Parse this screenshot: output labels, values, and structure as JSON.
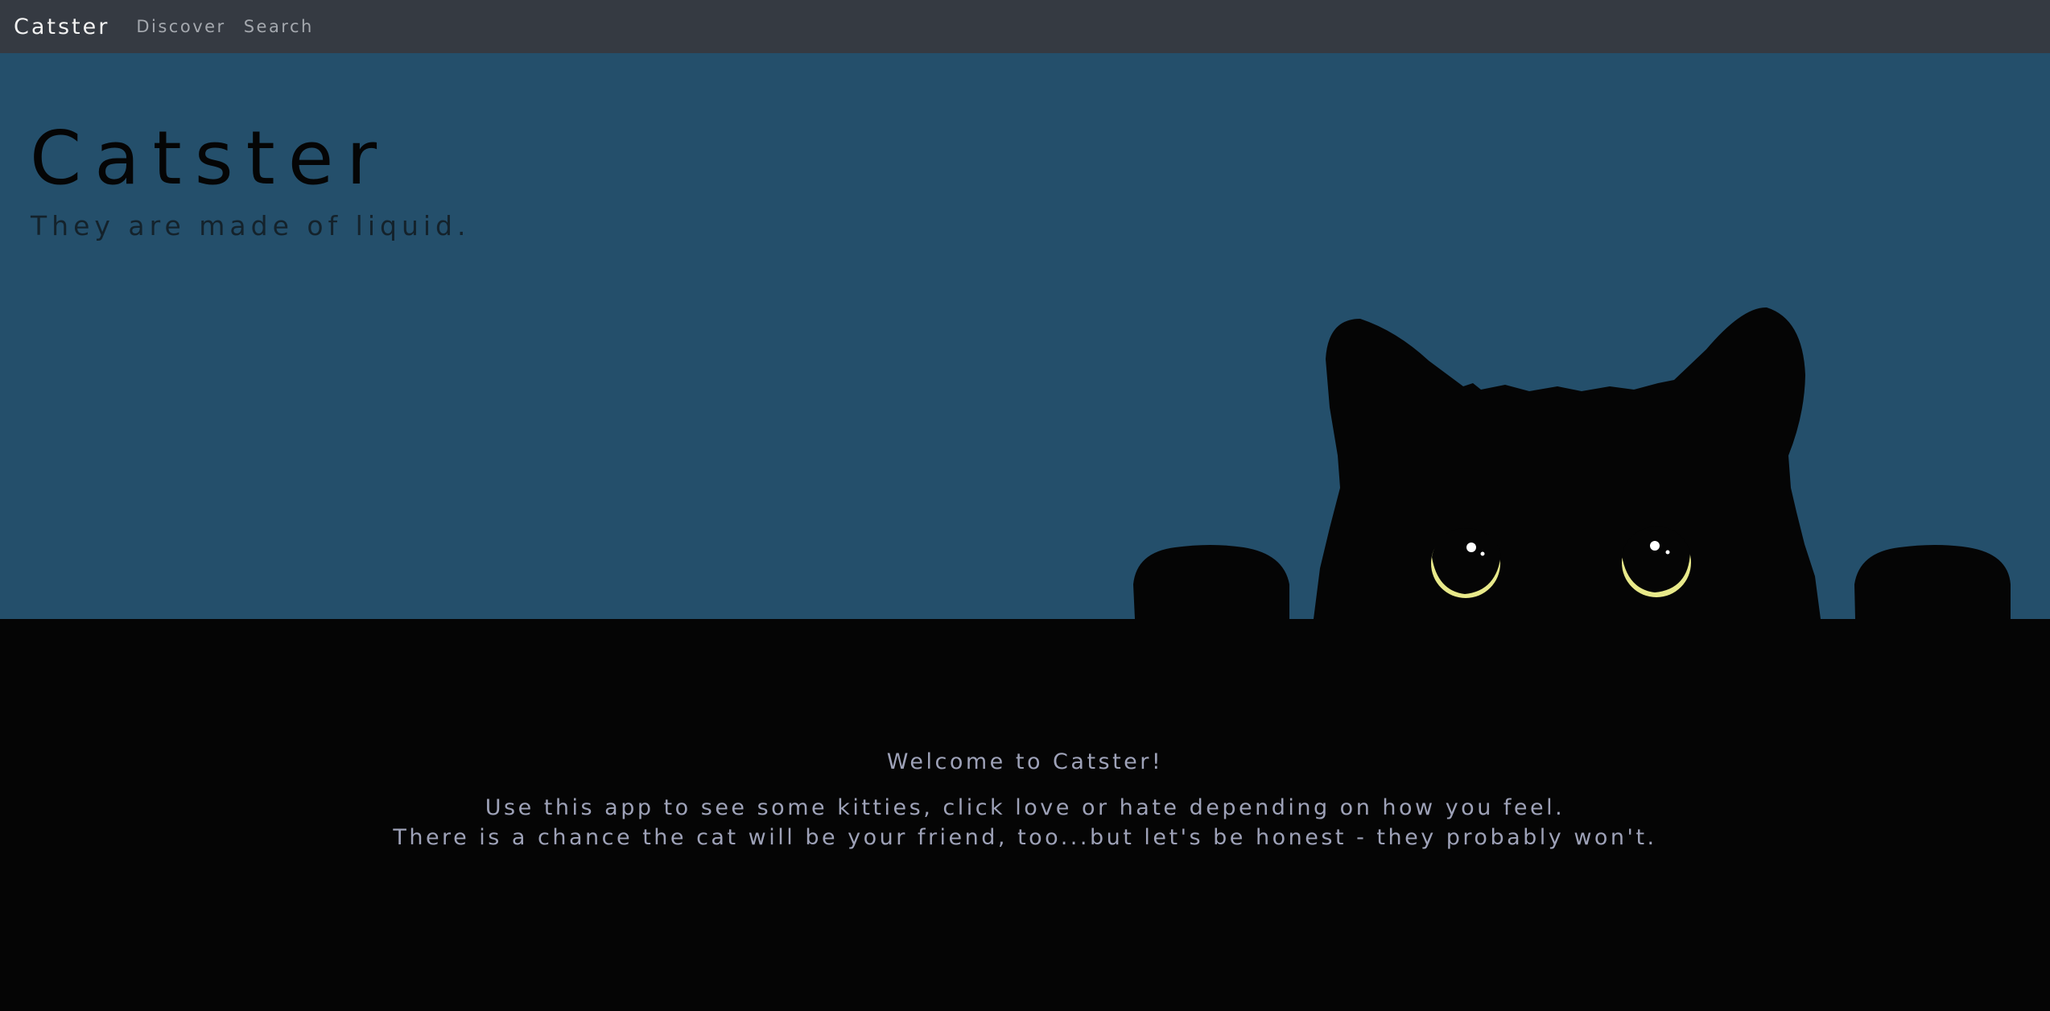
{
  "navbar": {
    "brand": "Catster",
    "links": [
      "Discover",
      "Search"
    ]
  },
  "hero": {
    "title": "Catster",
    "subtitle": "They are made of liquid."
  },
  "content": {
    "welcome": "Welcome to Catster!",
    "description_lines": [
      "Use this app to see some kitties, click love or hate depending on how you feel.",
      "There is a chance the cat will be your friend, too...but let's be honest - they probably won't."
    ]
  },
  "colors": {
    "navbar_bg": "#353a42",
    "hero_bg": "#244f6b",
    "page_bg": "#050505",
    "cat_eye": "#e8e98a",
    "text_muted": "#9ea2b8"
  }
}
